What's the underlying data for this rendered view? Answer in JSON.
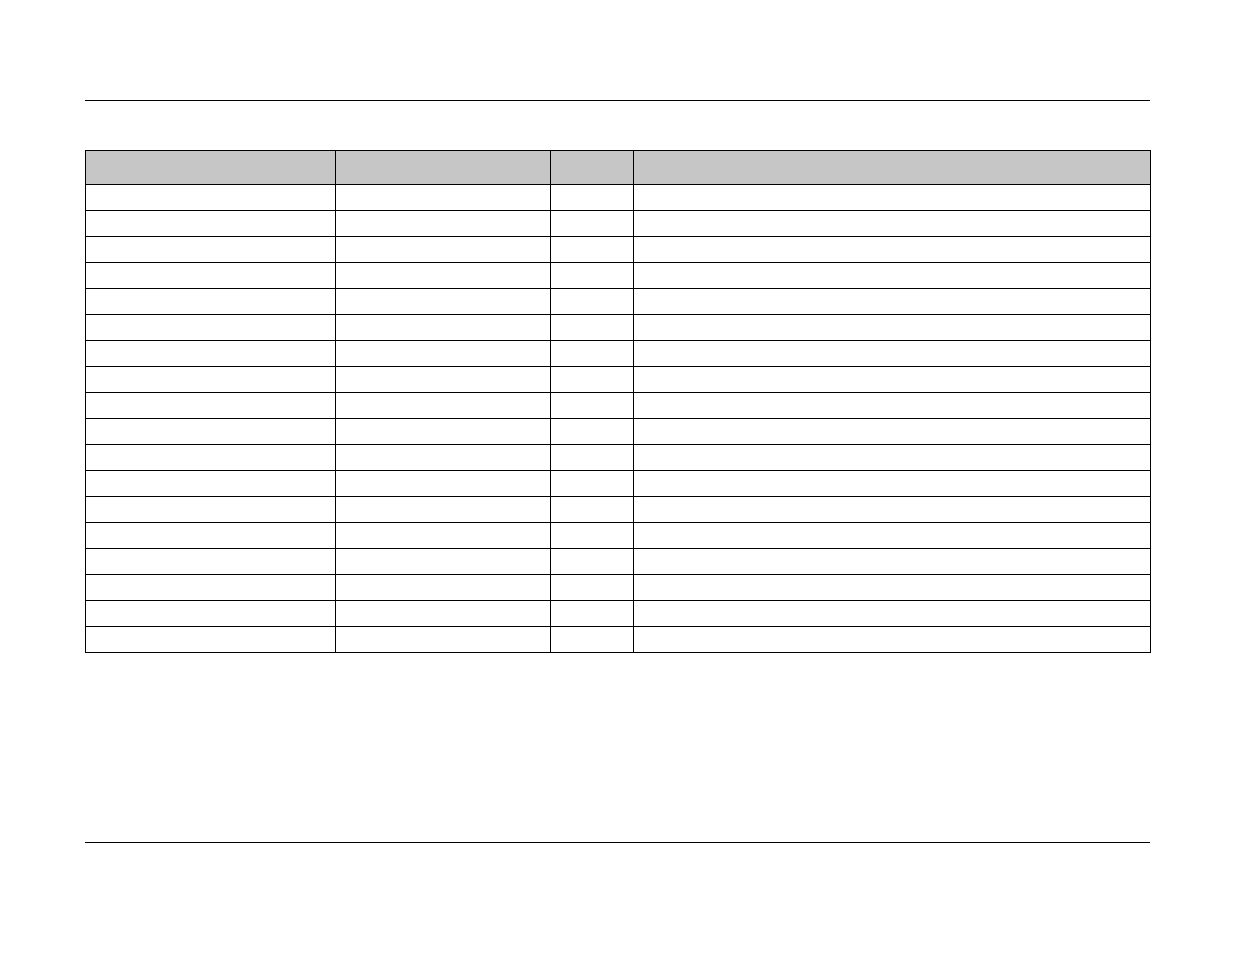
{
  "table": {
    "headers": [
      "",
      "",
      "",
      ""
    ],
    "rows": [
      [
        "",
        "",
        "",
        ""
      ],
      [
        "",
        "",
        "",
        ""
      ],
      [
        "",
        "",
        "",
        ""
      ],
      [
        "",
        "",
        "",
        ""
      ],
      [
        "",
        "",
        "",
        ""
      ],
      [
        "",
        "",
        "",
        ""
      ],
      [
        "",
        "",
        "",
        ""
      ],
      [
        "",
        "",
        "",
        ""
      ],
      [
        "",
        "",
        "",
        ""
      ],
      [
        "",
        "",
        "",
        ""
      ],
      [
        "",
        "",
        "",
        ""
      ],
      [
        "",
        "",
        "",
        ""
      ],
      [
        "",
        "",
        "",
        ""
      ],
      [
        "",
        "",
        "",
        ""
      ],
      [
        "",
        "",
        "",
        ""
      ],
      [
        "",
        "",
        "",
        ""
      ],
      [
        "",
        "",
        "",
        ""
      ],
      [
        "",
        "",
        "",
        ""
      ]
    ]
  }
}
